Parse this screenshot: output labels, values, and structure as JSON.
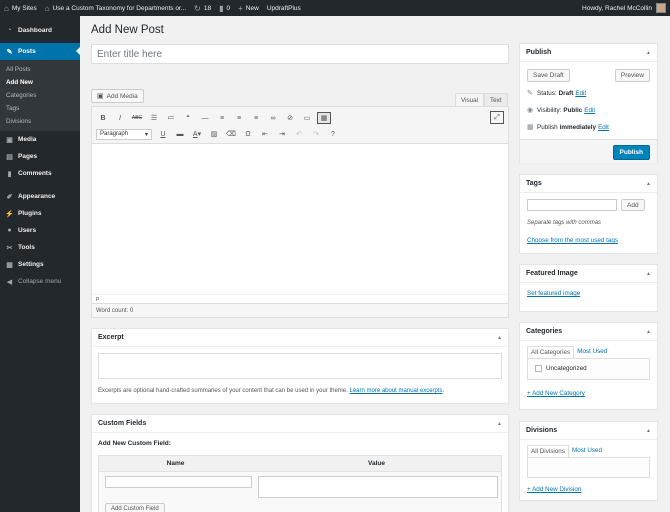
{
  "adminbar": {
    "my_sites": "My Sites",
    "site_name": "Use a Custom Taxonomy for Departments or...",
    "updates_count": "18",
    "comments_count": "0",
    "new_label": "New",
    "plugin_label": "UpdraftPlus",
    "howdy": "Howdy, Rachel McCollin"
  },
  "sidebar": {
    "dashboard": "Dashboard",
    "posts": "Posts",
    "sub": [
      "All Posts",
      "Add New",
      "Categories",
      "Tags",
      "Divisions"
    ],
    "media": "Media",
    "pages": "Pages",
    "comments": "Comments",
    "appearance": "Appearance",
    "plugins": "Plugins",
    "users": "Users",
    "tools": "Tools",
    "settings": "Settings",
    "collapse": "Collapse menu"
  },
  "main": {
    "page_title": "Add New Post",
    "title_placeholder": "Enter title here",
    "add_media": "Add Media",
    "tab_visual": "Visual",
    "tab_text": "Text",
    "format_select": "Paragraph",
    "path": "p",
    "word_count": "Word count: 0"
  },
  "excerpt": {
    "title": "Excerpt",
    "help": "Excerpts are optional hand-crafted summaries of your content that can be used in your theme.",
    "help_link": "Learn more about manual excerpts"
  },
  "custom_fields": {
    "title": "Custom Fields",
    "subtitle": "Add New Custom Field:",
    "col_name": "Name",
    "col_value": "Value",
    "add_button": "Add Custom Field"
  },
  "publish": {
    "title": "Publish",
    "save_draft": "Save Draft",
    "preview": "Preview",
    "status_label": "Status:",
    "status_value": "Draft",
    "visibility_label": "Visibility:",
    "visibility_value": "Public",
    "publish_label": "Publish",
    "publish_value": "immediately",
    "edit": "Edit",
    "publish_button": "Publish"
  },
  "tags": {
    "title": "Tags",
    "add_button": "Add",
    "help": "Separate tags with commas",
    "most_used": "Choose from the most used tags"
  },
  "featured_image": {
    "title": "Featured Image",
    "link": "Set featured image"
  },
  "categories": {
    "title": "Categories",
    "tab_all": "All Categories",
    "tab_most": "Most Used",
    "item": "Uncategorized",
    "add_new": "+ Add New Category"
  },
  "divisions": {
    "title": "Divisions",
    "tab_all": "All Divisions",
    "tab_most": "Most Used",
    "add_new": "+ Add New Division"
  },
  "colors": {
    "admin_dark": "#23282d",
    "accent": "#0073aa",
    "publish_button": "#0085ba"
  }
}
